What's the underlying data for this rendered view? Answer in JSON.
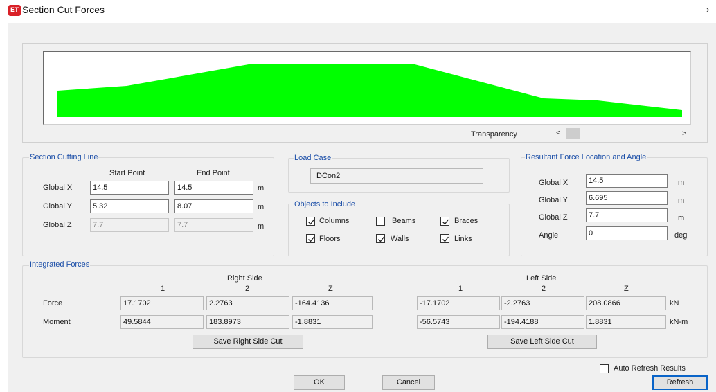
{
  "window": {
    "title": "Section Cut Forces",
    "icon_text": "ET",
    "close_glyph": "›"
  },
  "preview": {
    "fill_color": "#00ff00",
    "transparency_label": "Transparency",
    "scroll_left_glyph": "<",
    "scroll_right_glyph": ">"
  },
  "section_cutting_line": {
    "title": "Section Cutting Line",
    "col_start": "Start Point",
    "col_end": "End Point",
    "rows": [
      {
        "label": "Global  X",
        "start": "14.5",
        "end": "14.5",
        "unit": "m"
      },
      {
        "label": "Global  Y",
        "start": "5.32",
        "end": "8.07",
        "unit": "m"
      },
      {
        "label": "Global  Z",
        "start": "7.7",
        "end": "7.7",
        "unit": "m"
      }
    ]
  },
  "load_case": {
    "title": "Load Case",
    "value": "DCon2"
  },
  "objects_to_include": {
    "title": "Objects to Include",
    "items": [
      {
        "label": "Columns",
        "checked": true
      },
      {
        "label": "Beams",
        "checked": false
      },
      {
        "label": "Braces",
        "checked": true
      },
      {
        "label": "Floors",
        "checked": true
      },
      {
        "label": "Walls",
        "checked": true
      },
      {
        "label": "Links",
        "checked": true
      }
    ]
  },
  "resultant": {
    "title": "Resultant Force Location and Angle",
    "rows": [
      {
        "label": "Global  X",
        "value": "14.5",
        "unit": "m"
      },
      {
        "label": "Global  Y",
        "value": "6.695",
        "unit": "m"
      },
      {
        "label": "Global  Z",
        "value": "7.7",
        "unit": "m"
      },
      {
        "label": "Angle",
        "value": "0",
        "unit": "deg"
      }
    ]
  },
  "integrated_forces": {
    "title": "Integrated Forces",
    "right_side_label": "Right Side",
    "left_side_label": "Left Side",
    "col_headers": [
      "1",
      "2",
      "Z"
    ],
    "row_labels": [
      "Force",
      "Moment"
    ],
    "units": [
      "kN",
      "kN-m"
    ],
    "right": [
      [
        "17.1702",
        "2.2763",
        "-164.4136"
      ],
      [
        "49.5844",
        "183.8973",
        "-1.8831"
      ]
    ],
    "left": [
      [
        "-17.1702",
        "-2.2763",
        "208.0866"
      ],
      [
        "-56.5743",
        "-194.4188",
        "1.8831"
      ]
    ],
    "save_right_label": "Save Right Side Cut",
    "save_left_label": "Save Left Side Cut"
  },
  "footer": {
    "auto_refresh_label": "Auto Refresh Results",
    "auto_refresh_checked": false,
    "ok_label": "OK",
    "cancel_label": "Cancel",
    "refresh_label": "Refresh"
  }
}
